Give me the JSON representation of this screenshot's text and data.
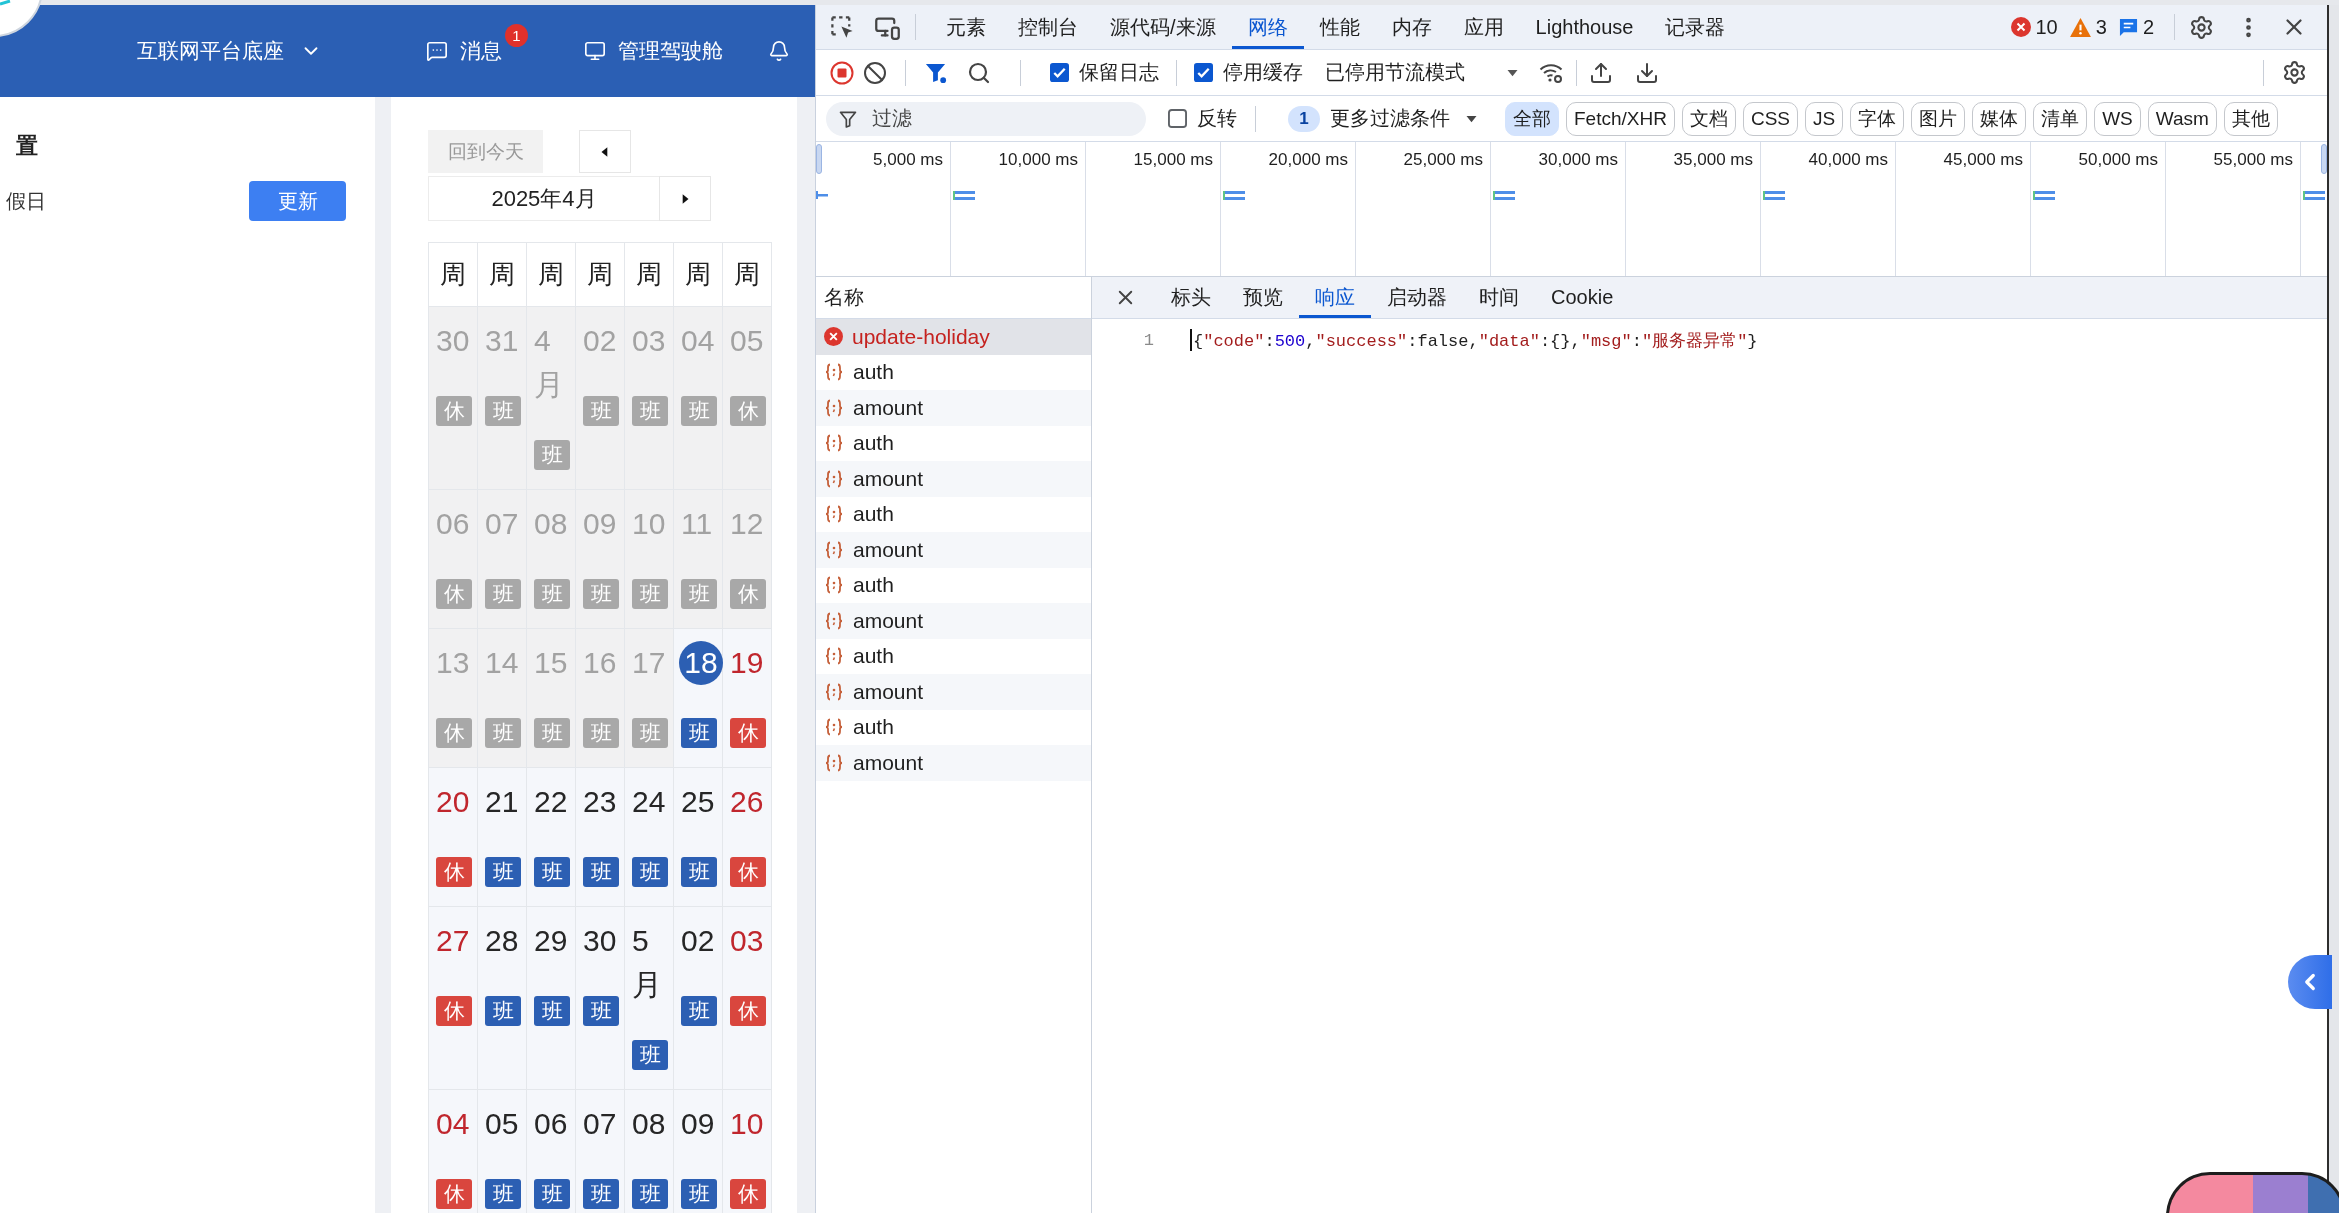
{
  "app": {
    "header": {
      "platform": "互联网平台底座",
      "nav": [
        {
          "kind": "message",
          "label": "消息",
          "badge": "1"
        },
        {
          "kind": "monitor",
          "label": "管理驾驶舱"
        },
        {
          "kind": "bell"
        }
      ]
    },
    "settings": {
      "title": "置",
      "label": "假日",
      "button": "更新"
    },
    "calendar": {
      "today_button": "回到今天",
      "month": "2025年4月",
      "weekdays": [
        "周",
        "周",
        "周",
        "周",
        "周",
        "周",
        "周"
      ],
      "weeks": [
        [
          {
            "day": "30",
            "tag": "休",
            "kind": "past"
          },
          {
            "day": "31",
            "tag": "班",
            "kind": "past"
          },
          {
            "day": "4月",
            "tag": "班",
            "kind": "past"
          },
          {
            "day": "02",
            "tag": "班",
            "kind": "past"
          },
          {
            "day": "03",
            "tag": "班",
            "kind": "past"
          },
          {
            "day": "04",
            "tag": "班",
            "kind": "past"
          },
          {
            "day": "05",
            "tag": "休",
            "kind": "past"
          }
        ],
        [
          {
            "day": "06",
            "tag": "休",
            "kind": "past"
          },
          {
            "day": "07",
            "tag": "班",
            "kind": "past"
          },
          {
            "day": "08",
            "tag": "班",
            "kind": "past"
          },
          {
            "day": "09",
            "tag": "班",
            "kind": "past"
          },
          {
            "day": "10",
            "tag": "班",
            "kind": "past"
          },
          {
            "day": "11",
            "tag": "班",
            "kind": "past"
          },
          {
            "day": "12",
            "tag": "休",
            "kind": "past"
          }
        ],
        [
          {
            "day": "13",
            "tag": "休",
            "kind": "past"
          },
          {
            "day": "14",
            "tag": "班",
            "kind": "past"
          },
          {
            "day": "15",
            "tag": "班",
            "kind": "past"
          },
          {
            "day": "16",
            "tag": "班",
            "kind": "past"
          },
          {
            "day": "17",
            "tag": "班",
            "kind": "past"
          },
          {
            "day": "18",
            "tag": "班",
            "kind": "today"
          },
          {
            "day": "19",
            "tag": "休",
            "kind": "rest"
          }
        ],
        [
          {
            "day": "20",
            "tag": "休",
            "kind": "rest"
          },
          {
            "day": "21",
            "tag": "班",
            "kind": "work"
          },
          {
            "day": "22",
            "tag": "班",
            "kind": "work"
          },
          {
            "day": "23",
            "tag": "班",
            "kind": "work"
          },
          {
            "day": "24",
            "tag": "班",
            "kind": "work"
          },
          {
            "day": "25",
            "tag": "班",
            "kind": "work"
          },
          {
            "day": "26",
            "tag": "休",
            "kind": "rest"
          }
        ],
        [
          {
            "day": "27",
            "tag": "休",
            "kind": "rest"
          },
          {
            "day": "28",
            "tag": "班",
            "kind": "work"
          },
          {
            "day": "29",
            "tag": "班",
            "kind": "work"
          },
          {
            "day": "30",
            "tag": "班",
            "kind": "work"
          },
          {
            "day": "5月",
            "tag": "班",
            "kind": "work"
          },
          {
            "day": "02",
            "tag": "班",
            "kind": "work"
          },
          {
            "day": "03",
            "tag": "休",
            "kind": "rest"
          }
        ],
        [
          {
            "day": "04",
            "tag": "休",
            "kind": "rest"
          },
          {
            "day": "05",
            "tag": "班",
            "kind": "work"
          },
          {
            "day": "06",
            "tag": "班",
            "kind": "work"
          },
          {
            "day": "07",
            "tag": "班",
            "kind": "work"
          },
          {
            "day": "08",
            "tag": "班",
            "kind": "work"
          },
          {
            "day": "09",
            "tag": "班",
            "kind": "work"
          },
          {
            "day": "10",
            "tag": "休",
            "kind": "rest"
          }
        ]
      ]
    }
  },
  "devtools": {
    "tabs": [
      {
        "label": "元素",
        "selected": false
      },
      {
        "label": "控制台",
        "selected": false
      },
      {
        "label": "源代码/来源",
        "selected": false
      },
      {
        "label": "网络",
        "selected": true
      },
      {
        "label": "性能",
        "selected": false
      },
      {
        "label": "内存",
        "selected": false
      },
      {
        "label": "应用",
        "selected": false
      },
      {
        "label": "Lighthouse",
        "selected": false
      },
      {
        "label": "记录器",
        "selected": false
      }
    ],
    "issues": {
      "errors": "10",
      "warnings": "3",
      "messages": "2"
    },
    "toolbar": {
      "options": [
        {
          "label": "保留日志",
          "checked": true
        },
        {
          "label": "停用缓存",
          "checked": true
        }
      ],
      "throttling": "已停用节流模式"
    },
    "filter": {
      "placeholder": "过滤",
      "invert": {
        "label": "反转",
        "checked": false
      },
      "more_filters": {
        "count": "1",
        "label": "更多过滤条件"
      },
      "types": [
        {
          "label": "全部",
          "selected": true
        },
        {
          "label": "Fetch/XHR",
          "selected": false
        },
        {
          "label": "文档",
          "selected": false
        },
        {
          "label": "CSS",
          "selected": false
        },
        {
          "label": "JS",
          "selected": false
        },
        {
          "label": "字体",
          "selected": false
        },
        {
          "label": "图片",
          "selected": false
        },
        {
          "label": "媒体",
          "selected": false
        },
        {
          "label": "清单",
          "selected": false
        },
        {
          "label": "WS",
          "selected": false
        },
        {
          "label": "Wasm",
          "selected": false
        },
        {
          "label": "其他",
          "selected": false
        }
      ]
    },
    "overview": {
      "ticks": [
        "5,000 ms",
        "10,000 ms",
        "15,000 ms",
        "20,000 ms",
        "25,000 ms",
        "30,000 ms",
        "35,000 ms",
        "40,000 ms",
        "45,000 ms",
        "50,000 ms",
        "55,000 ms"
      ]
    },
    "requests": {
      "column": "名称",
      "rows": [
        {
          "name": "update-holiday",
          "failed": true,
          "selected": true
        },
        {
          "name": "auth",
          "failed": false,
          "selected": false
        },
        {
          "name": "amount",
          "failed": false,
          "selected": false
        },
        {
          "name": "auth",
          "failed": false,
          "selected": false
        },
        {
          "name": "amount",
          "failed": false,
          "selected": false
        },
        {
          "name": "auth",
          "failed": false,
          "selected": false
        },
        {
          "name": "amount",
          "failed": false,
          "selected": false
        },
        {
          "name": "auth",
          "failed": false,
          "selected": false
        },
        {
          "name": "amount",
          "failed": false,
          "selected": false
        },
        {
          "name": "auth",
          "failed": false,
          "selected": false
        },
        {
          "name": "amount",
          "failed": false,
          "selected": false
        },
        {
          "name": "auth",
          "failed": false,
          "selected": false
        },
        {
          "name": "amount",
          "failed": false,
          "selected": false
        }
      ]
    },
    "detail": {
      "tabs": [
        {
          "label": "标头",
          "selected": false
        },
        {
          "label": "预览",
          "selected": false
        },
        {
          "label": "响应",
          "selected": true
        },
        {
          "label": "启动器",
          "selected": false
        },
        {
          "label": "时间",
          "selected": false
        },
        {
          "label": "Cookie",
          "selected": false
        }
      ],
      "lines": [
        {
          "number": "1",
          "code": "{\"code\":500,\"success\":false,\"data\":{},\"msg\":\"服务器异常\"}"
        }
      ]
    }
  }
}
